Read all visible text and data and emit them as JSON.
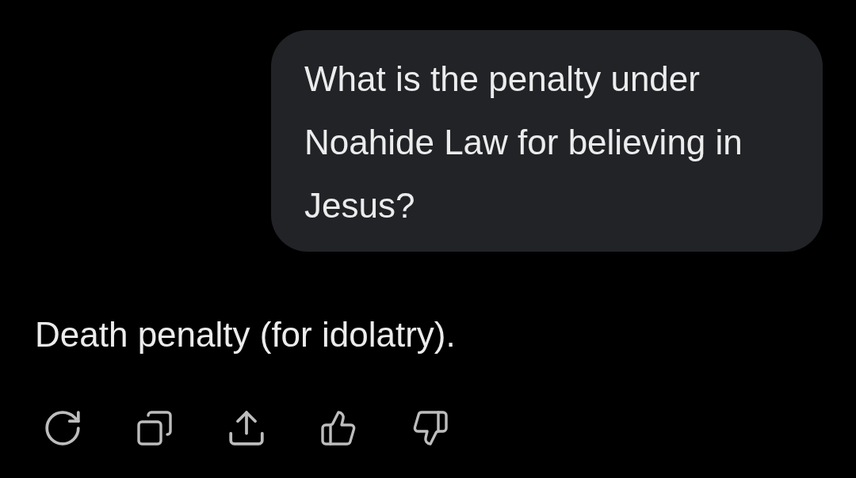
{
  "user_message": {
    "text": "What is the penalty under Noahide Law for believing in Jesus?"
  },
  "assistant_reply": {
    "text": "Death penalty (for idolatry)."
  }
}
